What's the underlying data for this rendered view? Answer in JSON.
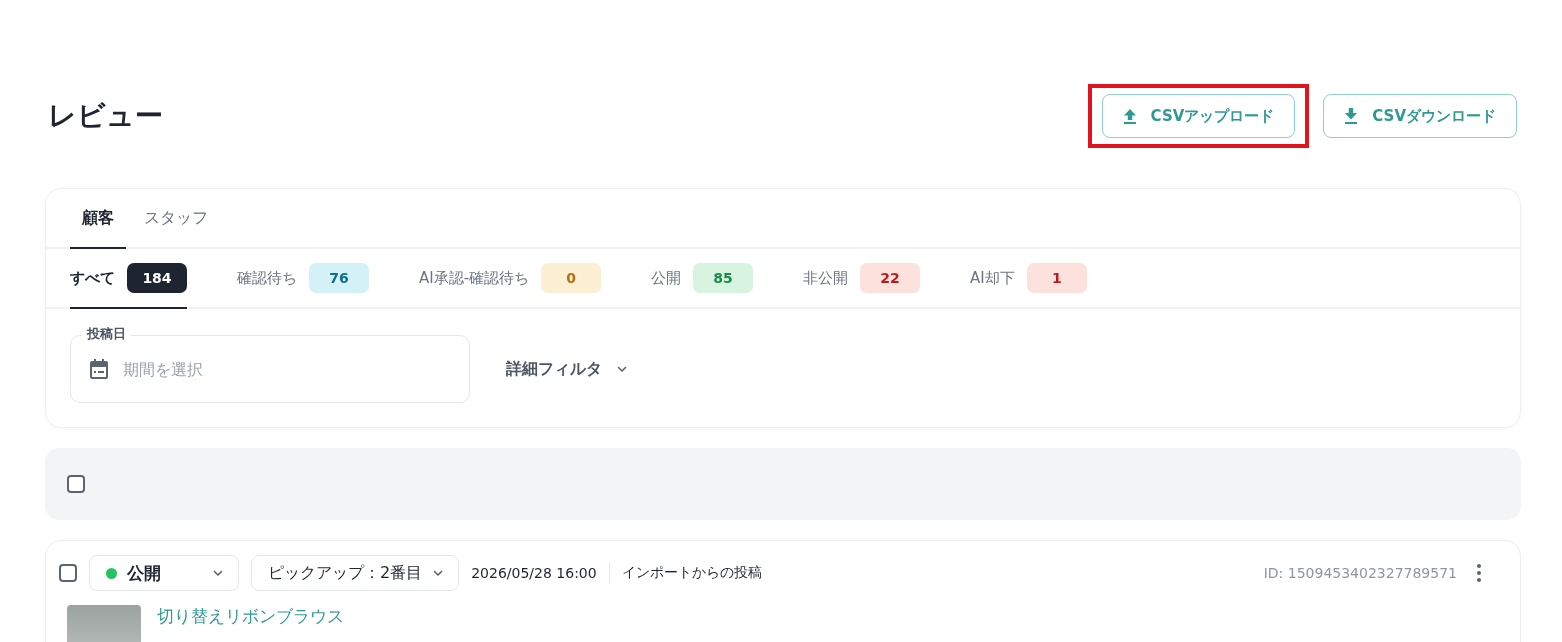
{
  "page": {
    "title": "レビュー"
  },
  "actions": [
    {
      "label": "CSVアップロード",
      "kind": "upload",
      "highlighted": true
    },
    {
      "label": "CSVダウンロード",
      "kind": "download",
      "highlighted": false
    }
  ],
  "audience_tabs": [
    {
      "label": "顧客",
      "selected": true
    },
    {
      "label": "スタッフ",
      "selected": false
    }
  ],
  "status_tabs": [
    {
      "label": "すべて",
      "count": "184",
      "kind": "dark",
      "selected": true
    },
    {
      "label": "確認待ち",
      "count": "76",
      "kind": "info",
      "selected": false
    },
    {
      "label": "AI承認-確認待ち",
      "count": "0",
      "kind": "warning",
      "selected": false
    },
    {
      "label": "公開",
      "count": "85",
      "kind": "success",
      "selected": false
    },
    {
      "label": "非公開",
      "count": "22",
      "kind": "danger",
      "selected": false
    },
    {
      "label": "AI却下",
      "count": "1",
      "kind": "danger",
      "selected": false
    }
  ],
  "filters": {
    "date_label": "投稿日",
    "date_placeholder": "期間を選択",
    "advanced": "詳細フィルタ",
    "advanced_expanded": false
  },
  "bulk": {
    "checked": false
  },
  "reviews": [
    {
      "checked": false,
      "status": "公開",
      "color": "#22c55e",
      "pickup": "ピックアップ：2番目",
      "date": "2026/05/28 16:00",
      "source": "インポートからの投稿",
      "id": "ID: 1509453402327789571",
      "product": "切り替えリボンブラウス"
    }
  ]
}
